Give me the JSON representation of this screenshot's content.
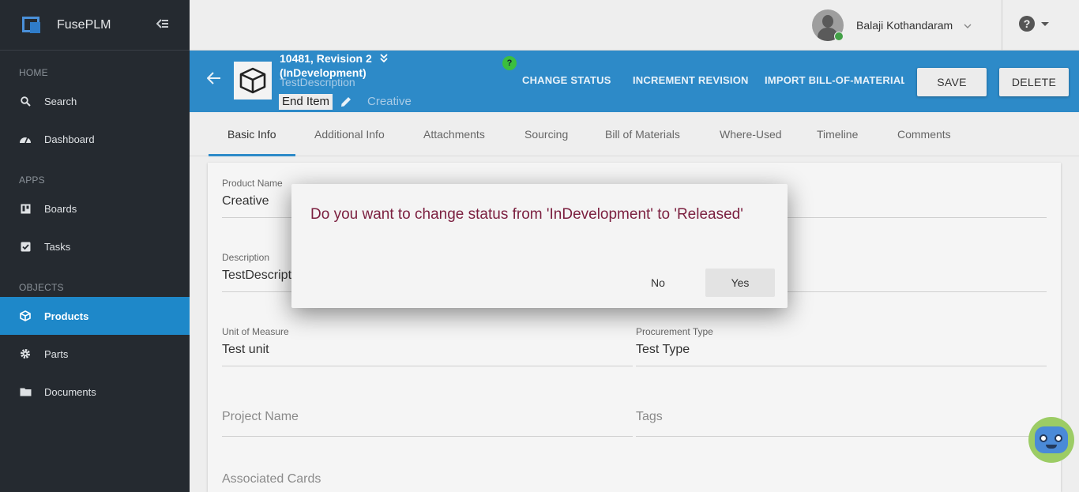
{
  "app": {
    "name": "FusePLM"
  },
  "sidebar": {
    "sections": [
      {
        "title": "HOME",
        "items": [
          {
            "label": "Search",
            "icon": "search-icon"
          },
          {
            "label": "Dashboard",
            "icon": "dashboard-icon"
          }
        ]
      },
      {
        "title": "APPS",
        "items": [
          {
            "label": "Boards",
            "icon": "boards-icon"
          },
          {
            "label": "Tasks",
            "icon": "tasks-icon"
          }
        ]
      },
      {
        "title": "OBJECTS",
        "items": [
          {
            "label": "Products",
            "icon": "cube-icon",
            "active": true
          },
          {
            "label": "Parts",
            "icon": "gear-icon"
          },
          {
            "label": "Documents",
            "icon": "folder-icon"
          }
        ]
      }
    ]
  },
  "topbar": {
    "user_name": "Balaji Kothandaram"
  },
  "product": {
    "id_line": "10481,  Revision 2",
    "status_line": "(InDevelopment)",
    "description": "TestDescription",
    "type_tag": "End Item",
    "name": "Creative",
    "help_badge": "?"
  },
  "actions": {
    "change_status": "CHANGE STATUS",
    "increment_revision": "INCREMENT REVISION",
    "import_bom": "IMPORT BILL-OF-MATERIAL",
    "save": "SAVE",
    "delete": "DELETE"
  },
  "tabs": [
    "Basic Info",
    "Additional Info",
    "Attachments",
    "Sourcing",
    "Bill of Materials",
    "Where-Used",
    "Timeline",
    "Comments"
  ],
  "form": {
    "product_name": {
      "label": "Product Name",
      "value": "Creative"
    },
    "description": {
      "label": "Description",
      "value": "TestDescription"
    },
    "unit_of_measure": {
      "label": "Unit of Measure",
      "value": "Test unit"
    },
    "procurement_type": {
      "label": "Procurement Type",
      "value": "Test Type"
    },
    "project_name": {
      "placeholder": "Project Name"
    },
    "tags": {
      "placeholder": "Tags"
    },
    "associated_cards": {
      "placeholder": "Associated Cards"
    }
  },
  "dialog": {
    "message": "Do you want to change status from 'InDevelopment' to 'Released'",
    "no": "No",
    "yes": "Yes"
  },
  "colors": {
    "accent": "#2d8ac8",
    "sidebar": "#252a30",
    "dialog_title": "#7b1f3f"
  }
}
